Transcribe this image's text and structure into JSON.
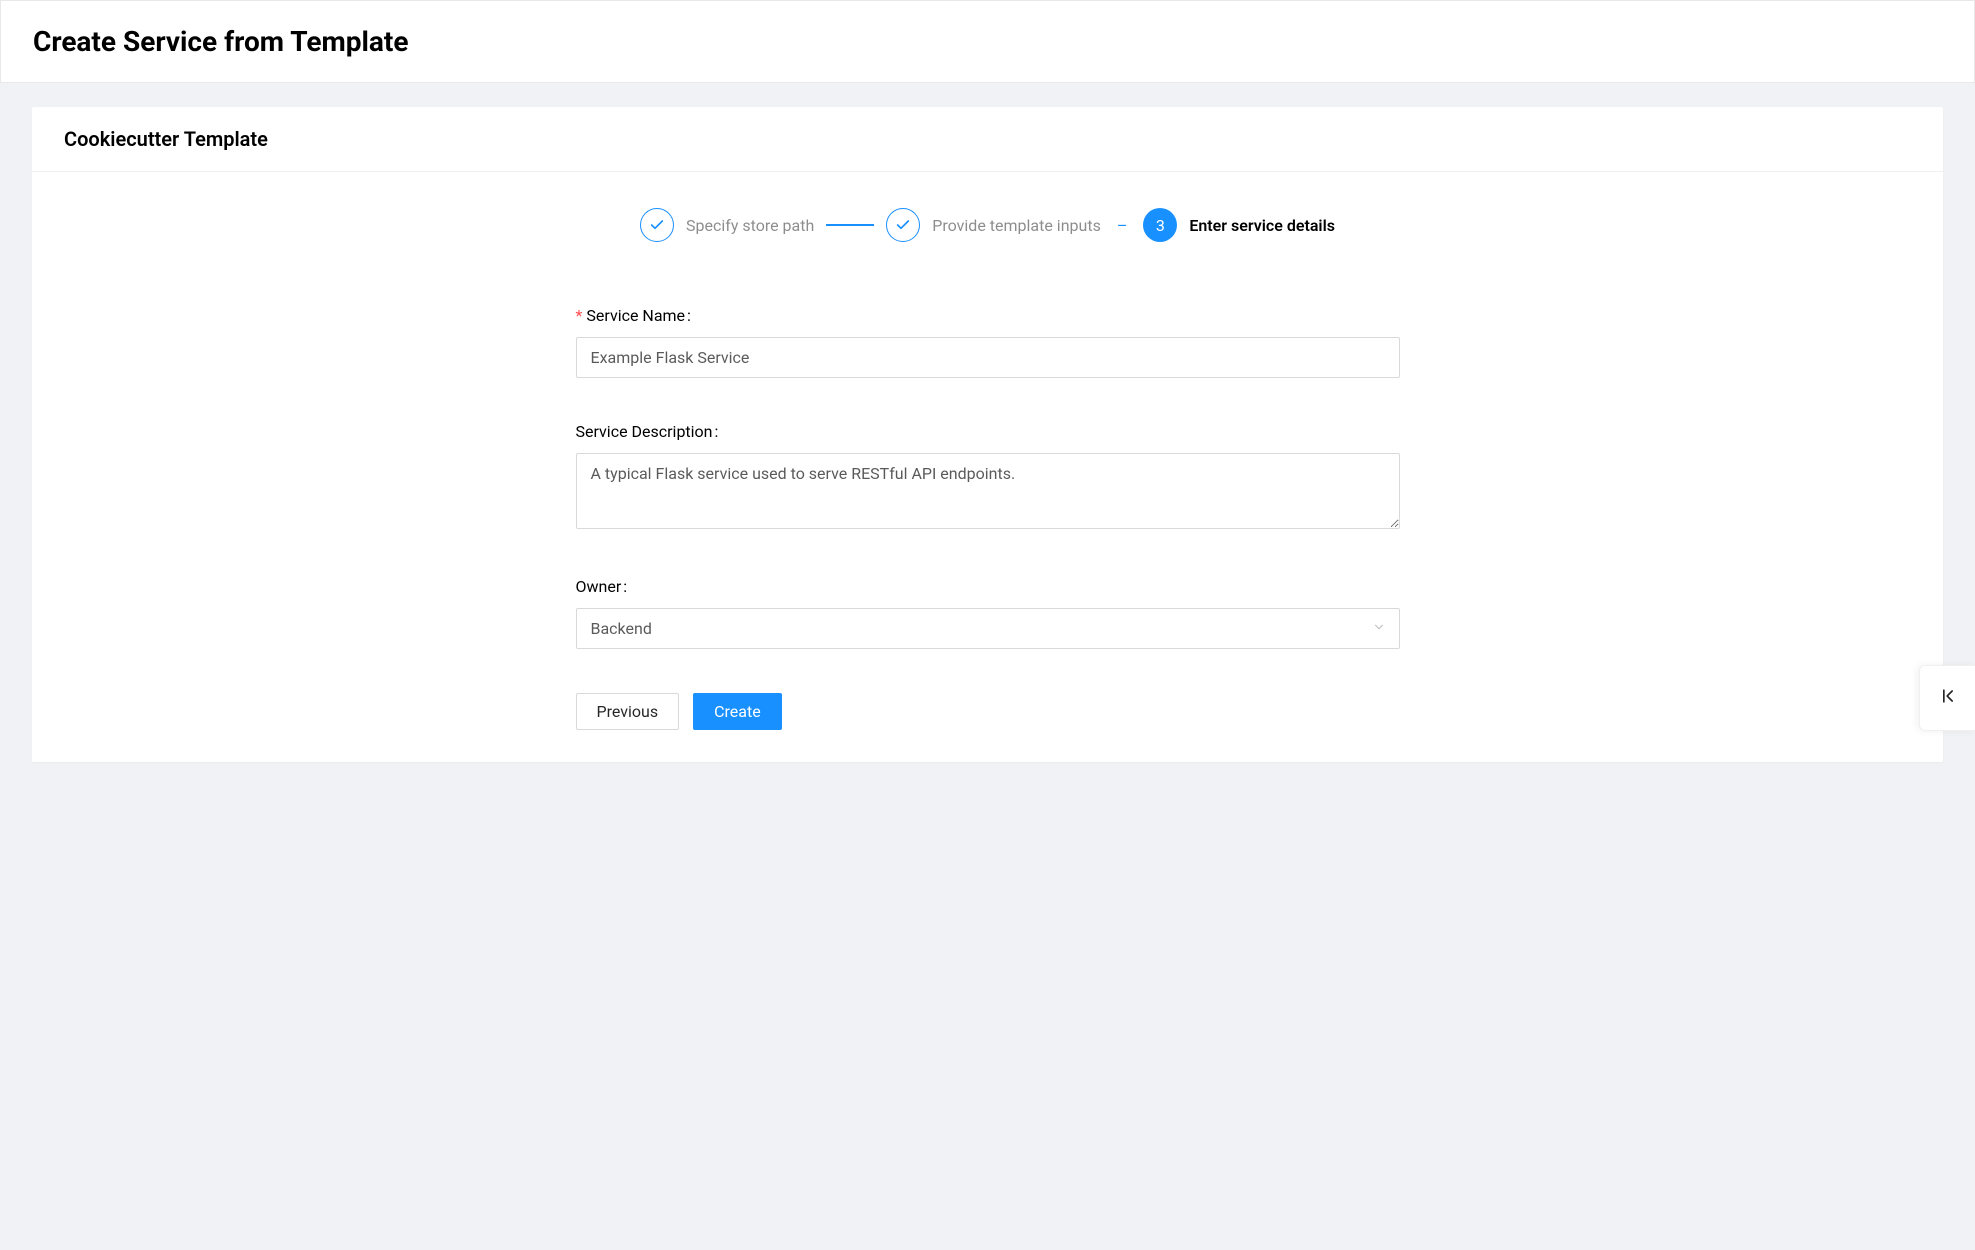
{
  "header": {
    "title": "Create Service from Template"
  },
  "card": {
    "title": "Cookiecutter Template"
  },
  "stepper": {
    "steps": [
      {
        "label": "Specify store path",
        "status": "done"
      },
      {
        "label": "Provide template inputs",
        "status": "done"
      },
      {
        "label": "Enter service details",
        "status": "current",
        "number": "3"
      }
    ]
  },
  "form": {
    "service_name": {
      "label": "Service Name",
      "value": "Example Flask Service",
      "required": true
    },
    "service_description": {
      "label": "Service Description",
      "value": "A typical Flask service used to serve RESTful API endpoints.",
      "required": false
    },
    "owner": {
      "label": "Owner",
      "value": "Backend",
      "required": false
    }
  },
  "buttons": {
    "previous": "Previous",
    "create": "Create"
  }
}
